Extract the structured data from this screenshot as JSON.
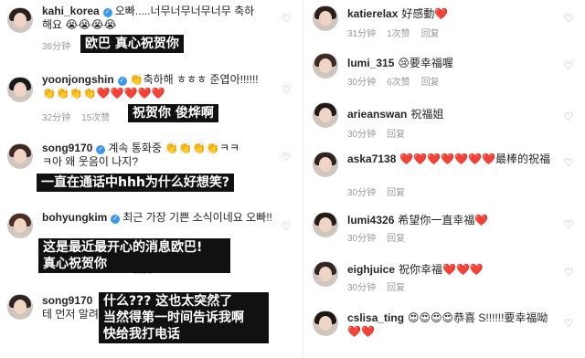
{
  "left": [
    {
      "user": "kahi_korea",
      "verified": true,
      "text_lines": [
        "오빠.....너무너무너무너무 축하",
        "해요 😭😭😭😭"
      ],
      "time": "38分钟",
      "likes": "",
      "caption": [
        "欧巴 真心祝贺你"
      ]
    },
    {
      "user": "yoonjongshin",
      "verified": true,
      "text_lines": [
        "👏축하해 ㅎㅎㅎ 준엽아!!!!!!",
        "👏👏👏👏❤️❤️❤️❤️❤️"
      ],
      "time": "32分钟",
      "likes": "15次赞",
      "caption": [
        "祝贺你 俊烨啊"
      ]
    },
    {
      "user": "song9170",
      "verified": true,
      "text_lines": [
        "계속 통화중 👏👏👏👏ㅋㅋ",
        "ㅋ아 왜 웃음이 나지?"
      ],
      "time": "",
      "likes": "",
      "caption": [
        "一直在通话中hhh为什么好想笑?"
      ]
    },
    {
      "user": "bohyungkim",
      "verified": true,
      "text_lines": [
        "최근 가장 기쁜 소식이네요 오빠!!"
      ],
      "time": "",
      "likes": "",
      "reply": "回复",
      "caption": [
        "这是最近最开心的消息欧巴!",
        "真心祝贺你"
      ]
    },
    {
      "user": "song9170",
      "verified": false,
      "text_lines": [
        "테 먼저 알려줘야 하지 않나 바로 전화"
      ],
      "time": "",
      "likes": "",
      "caption": [
        "什么??? 这也太突然了",
        "当然得第一时间告诉我啊",
        "快给我打电话"
      ]
    }
  ],
  "right": [
    {
      "user": "katierelax",
      "text": "好感動❤️",
      "time": "31分钟",
      "likes": "1次赞",
      "reply": "回复"
    },
    {
      "user": "lumi_315",
      "text": "😢要幸福喔",
      "time": "30分钟",
      "likes": "6次赞",
      "reply": "回复"
    },
    {
      "user": "arieanswan",
      "text": "祝福姐",
      "time": "30分钟",
      "likes": "",
      "reply": "回复"
    },
    {
      "user": "aska7138",
      "text": "❤️❤️❤️❤️❤️❤️❤️最棒的祝福",
      "time": "30分钟",
      "likes": "",
      "reply": "回复"
    },
    {
      "user": "lumi4326",
      "text": "希望你一直幸福❤️",
      "time": "30分钟",
      "likes": "",
      "reply": "回复"
    },
    {
      "user": "eighjuice",
      "text": "祝你幸福❤️❤️❤️",
      "time": "30分钟",
      "likes": "",
      "reply": "回复"
    },
    {
      "user": "cslisa_ting",
      "text": "😍😍😍😍恭喜 S!!!!!!要幸福呦❤️❤️",
      "time": "",
      "likes": "",
      "reply": ""
    }
  ],
  "icons": {
    "heart": "heart-outline-icon",
    "verified": "verified-badge-icon"
  },
  "colors": {
    "verified": "#3897f0",
    "meta": "#999999",
    "caption_bg": "#111111"
  }
}
